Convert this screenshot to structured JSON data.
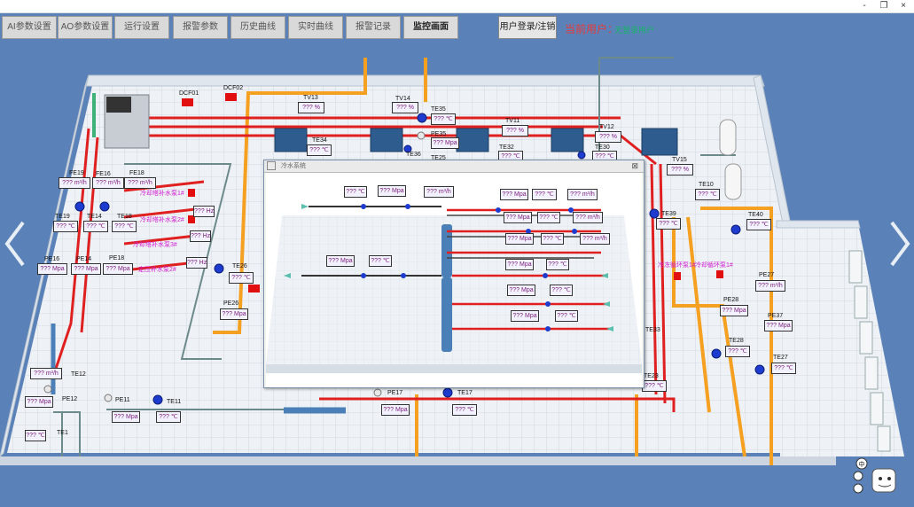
{
  "window": {
    "restore_glyph": "❐",
    "close_glyph": "×"
  },
  "tabs": [
    "AI参数设置",
    "AO参数设置",
    "运行设置",
    "报警参数",
    "历史曲线",
    "实时曲线",
    "报警记录",
    "监控画面"
  ],
  "active_tab": "监控画面",
  "login_label": "用户登录/注销",
  "current_user_label": "当前用户：",
  "no_user_label": "无登录用户",
  "popup": {
    "title": "冷水系统",
    "close_glyph": "⊠"
  },
  "placeholder": "???",
  "units": {
    "temp": "℃",
    "pressure": "Mpa",
    "flow": "m³/h",
    "percent": "%",
    "hz": "Hz"
  },
  "labels": {
    "dcf01": "DCF01",
    "dcf02": "DCF02",
    "tv13": "TV13",
    "tv14": "TV14",
    "te35": "TE35",
    "pe35": "PE35",
    "te25": "TE25",
    "tv11": "TV11",
    "te32": "TE32",
    "tv12": "TV12",
    "te30": "TE30",
    "tv15": "TV15",
    "te34": "TE34",
    "te36": "TE36",
    "fe19": "FE19",
    "fe16": "FE16",
    "fe18": "FE18",
    "te19": "TE19",
    "te14": "TE14",
    "te18": "TE18",
    "pe16": "PE16",
    "pe14": "PE14",
    "pe18": "PE18",
    "te26": "TE26",
    "pe26": "PE26",
    "te12": "TE12",
    "pe12": "PE12",
    "pe11": "PE11",
    "te11": "TE11",
    "te1": "TE1",
    "pe17": "PE17",
    "te17": "TE17",
    "te23": "TE23",
    "te33": "TE33",
    "te39": "TE39",
    "te40": "TE40",
    "te10": "TE10",
    "pe27": "PE27",
    "pe28": "PE28",
    "pe37": "PE37",
    "te28": "TE28",
    "te27": "TE27"
  },
  "pump_labels": {
    "p1": "冷却塔补水泵1#",
    "p2": "冷却塔补水泵2#",
    "p3": "冷却塔补水泵3#",
    "p4": "定压补水泵2#",
    "p5": "冷冻循环泵1#",
    "p6": "冷却循环泵1#"
  }
}
